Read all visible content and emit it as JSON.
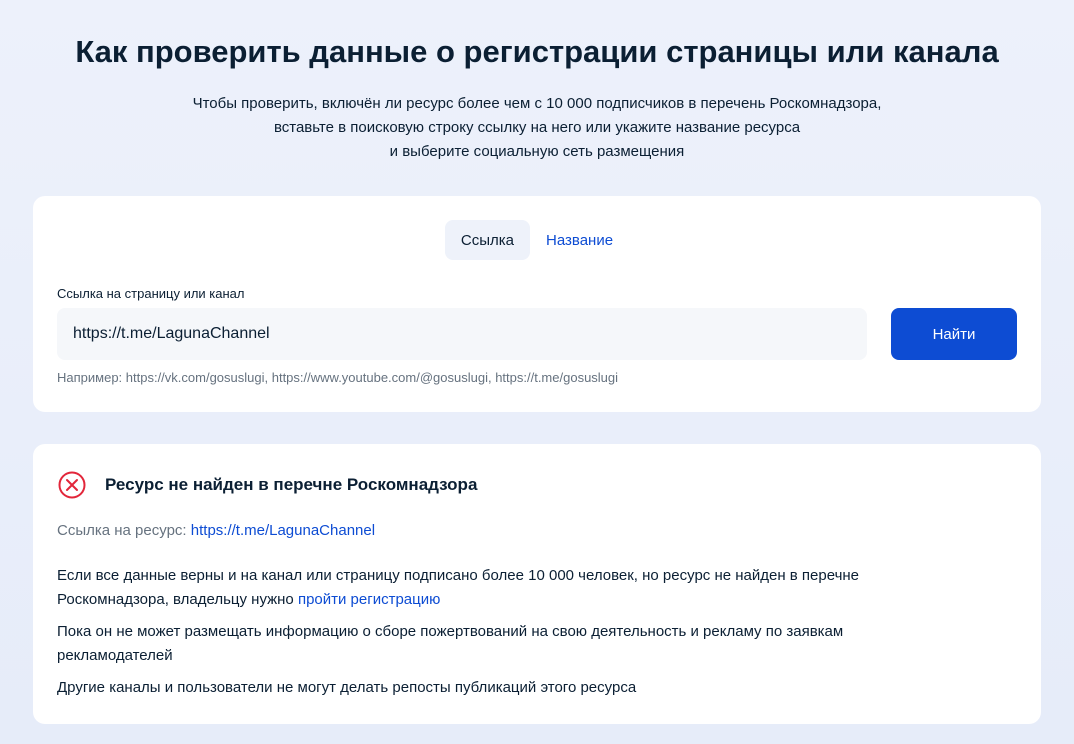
{
  "page": {
    "title": "Как проверить данные о регистрации страницы или канала",
    "subtitle_lines": [
      "Чтобы проверить, включён ли ресурс более чем с 10 000 подписчиков в перечень Роскомнадзора,",
      "вставьте в поисковую строку ссылку на него или укажите название ресурса",
      "и выберите социальную сеть размещения"
    ]
  },
  "search": {
    "tabs": [
      {
        "label": "Ссылка",
        "active": true
      },
      {
        "label": "Название",
        "active": false
      }
    ],
    "field_label": "Ссылка на страницу или канал",
    "input_value": "https://t.me/LagunaChannel",
    "button_label": "Найти",
    "hint": "Например: https://vk.com/gosuslugi, https://www.youtube.com/@gosuslugi, https://t.me/gosuslugi"
  },
  "result": {
    "icon": "error-circle-x-icon",
    "title": "Ресурс не найден в перечне Роскомнадзора",
    "resource_label": "Ссылка на ресурс:",
    "resource_link": "https://t.me/LagunaChannel",
    "para1_text": "Если все данные верны и на канал или страницу подписано более 10 000 человек, но ресурс не найден в перечне Роскомнадзора, владельцу нужно",
    "para1_link": "пройти регистрацию",
    "para2": "Пока он не может размещать информацию о сборе пожертвований на свою деятельность и рекламу по заявкам рекламодателей",
    "para3": "Другие каналы и пользователи не могут делать репосты публикаций этого ресурса"
  },
  "colors": {
    "accent": "#0d4cd3",
    "error": "#e2263a",
    "text": "#0b1f33",
    "muted": "#66727f",
    "background": "#e6ecf9"
  }
}
